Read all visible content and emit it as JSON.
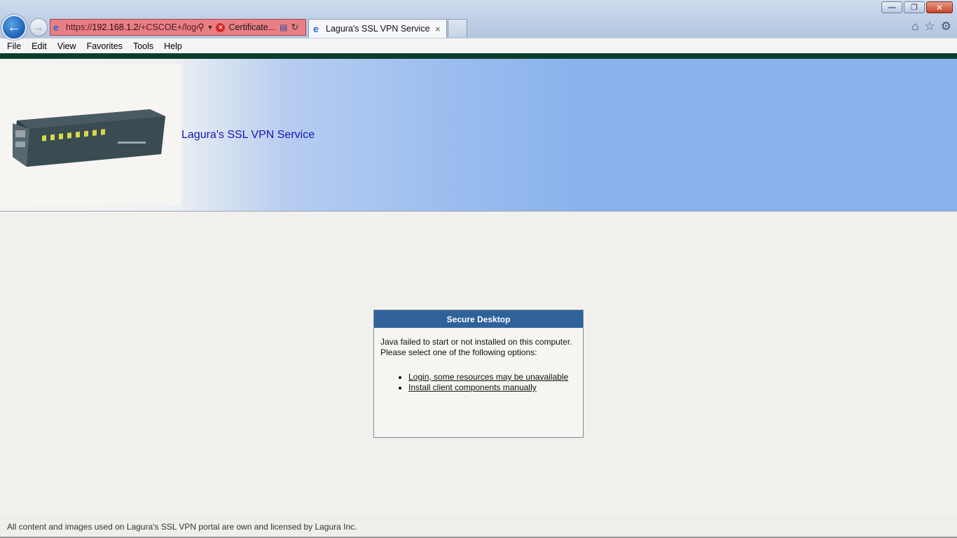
{
  "browser": {
    "url_prefix": "https://",
    "url_host": "192.168.1.2",
    "url_rest": "/+CSCOE+/logo",
    "cert_label": "Certificate...",
    "tab_title": "Lagura's SSL VPN Service",
    "tab_close": "×",
    "window_controls": {
      "minimize": "—",
      "restore": "❐",
      "close": "✕"
    },
    "icons": {
      "back": "arrow-left-icon",
      "forward": "arrow-right-icon",
      "home": "home-icon",
      "favorites": "star-icon",
      "tools": "gear-icon"
    }
  },
  "menu": {
    "items": [
      "File",
      "Edit",
      "View",
      "Favorites",
      "Tools",
      "Help"
    ]
  },
  "banner": {
    "title": "Lagura's SSL VPN Service"
  },
  "dialog": {
    "title": "Secure Desktop",
    "message_line1": "Java failed to start or not installed on this computer.",
    "message_line2": "Please select one of the following options:",
    "options": [
      "Login, some resources may be unavailable",
      "Install client components manually"
    ]
  },
  "footer": {
    "text": "All content and images used on Lagura's SSL VPN portal are own and licensed by Lagura Inc."
  }
}
